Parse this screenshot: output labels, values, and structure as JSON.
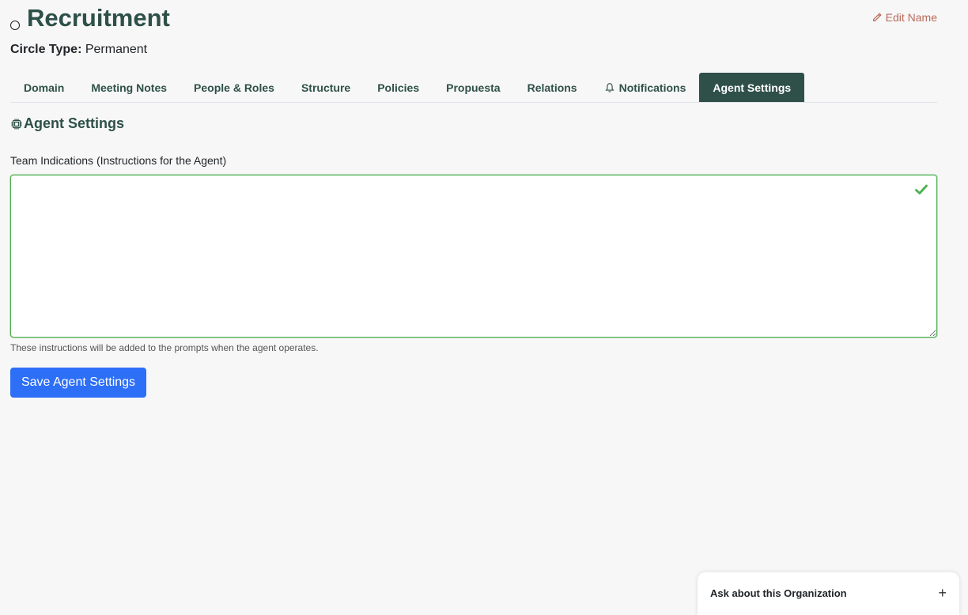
{
  "header": {
    "title": "Recruitment",
    "edit_label": "Edit Name",
    "circle_type_label": "Circle Type:",
    "circle_type_value": "Permanent"
  },
  "tabs": [
    {
      "label": "Domain",
      "active": false
    },
    {
      "label": "Meeting Notes",
      "active": false
    },
    {
      "label": "People & Roles",
      "active": false
    },
    {
      "label": "Structure",
      "active": false
    },
    {
      "label": "Policies",
      "active": false
    },
    {
      "label": "Propuesta",
      "active": false
    },
    {
      "label": "Relations",
      "active": false
    },
    {
      "label": "Notifications",
      "active": false,
      "icon": "bell-icon"
    },
    {
      "label": "Agent Settings",
      "active": true
    }
  ],
  "section": {
    "title": "Agent Settings",
    "icon": "cpu-icon"
  },
  "form": {
    "field_label": "Team Indications (Instructions for the Agent)",
    "field_value": "",
    "help_text": "These instructions will be added to the prompts when the agent operates.",
    "save_label": "Save Agent Settings"
  },
  "chat": {
    "title": "Ask about this Organization",
    "expand_symbol": "+"
  },
  "colors": {
    "primary": "#2f5049",
    "accent_button": "#2d6ff7",
    "valid": "#4caf50",
    "edit_link": "#b96a5a"
  }
}
